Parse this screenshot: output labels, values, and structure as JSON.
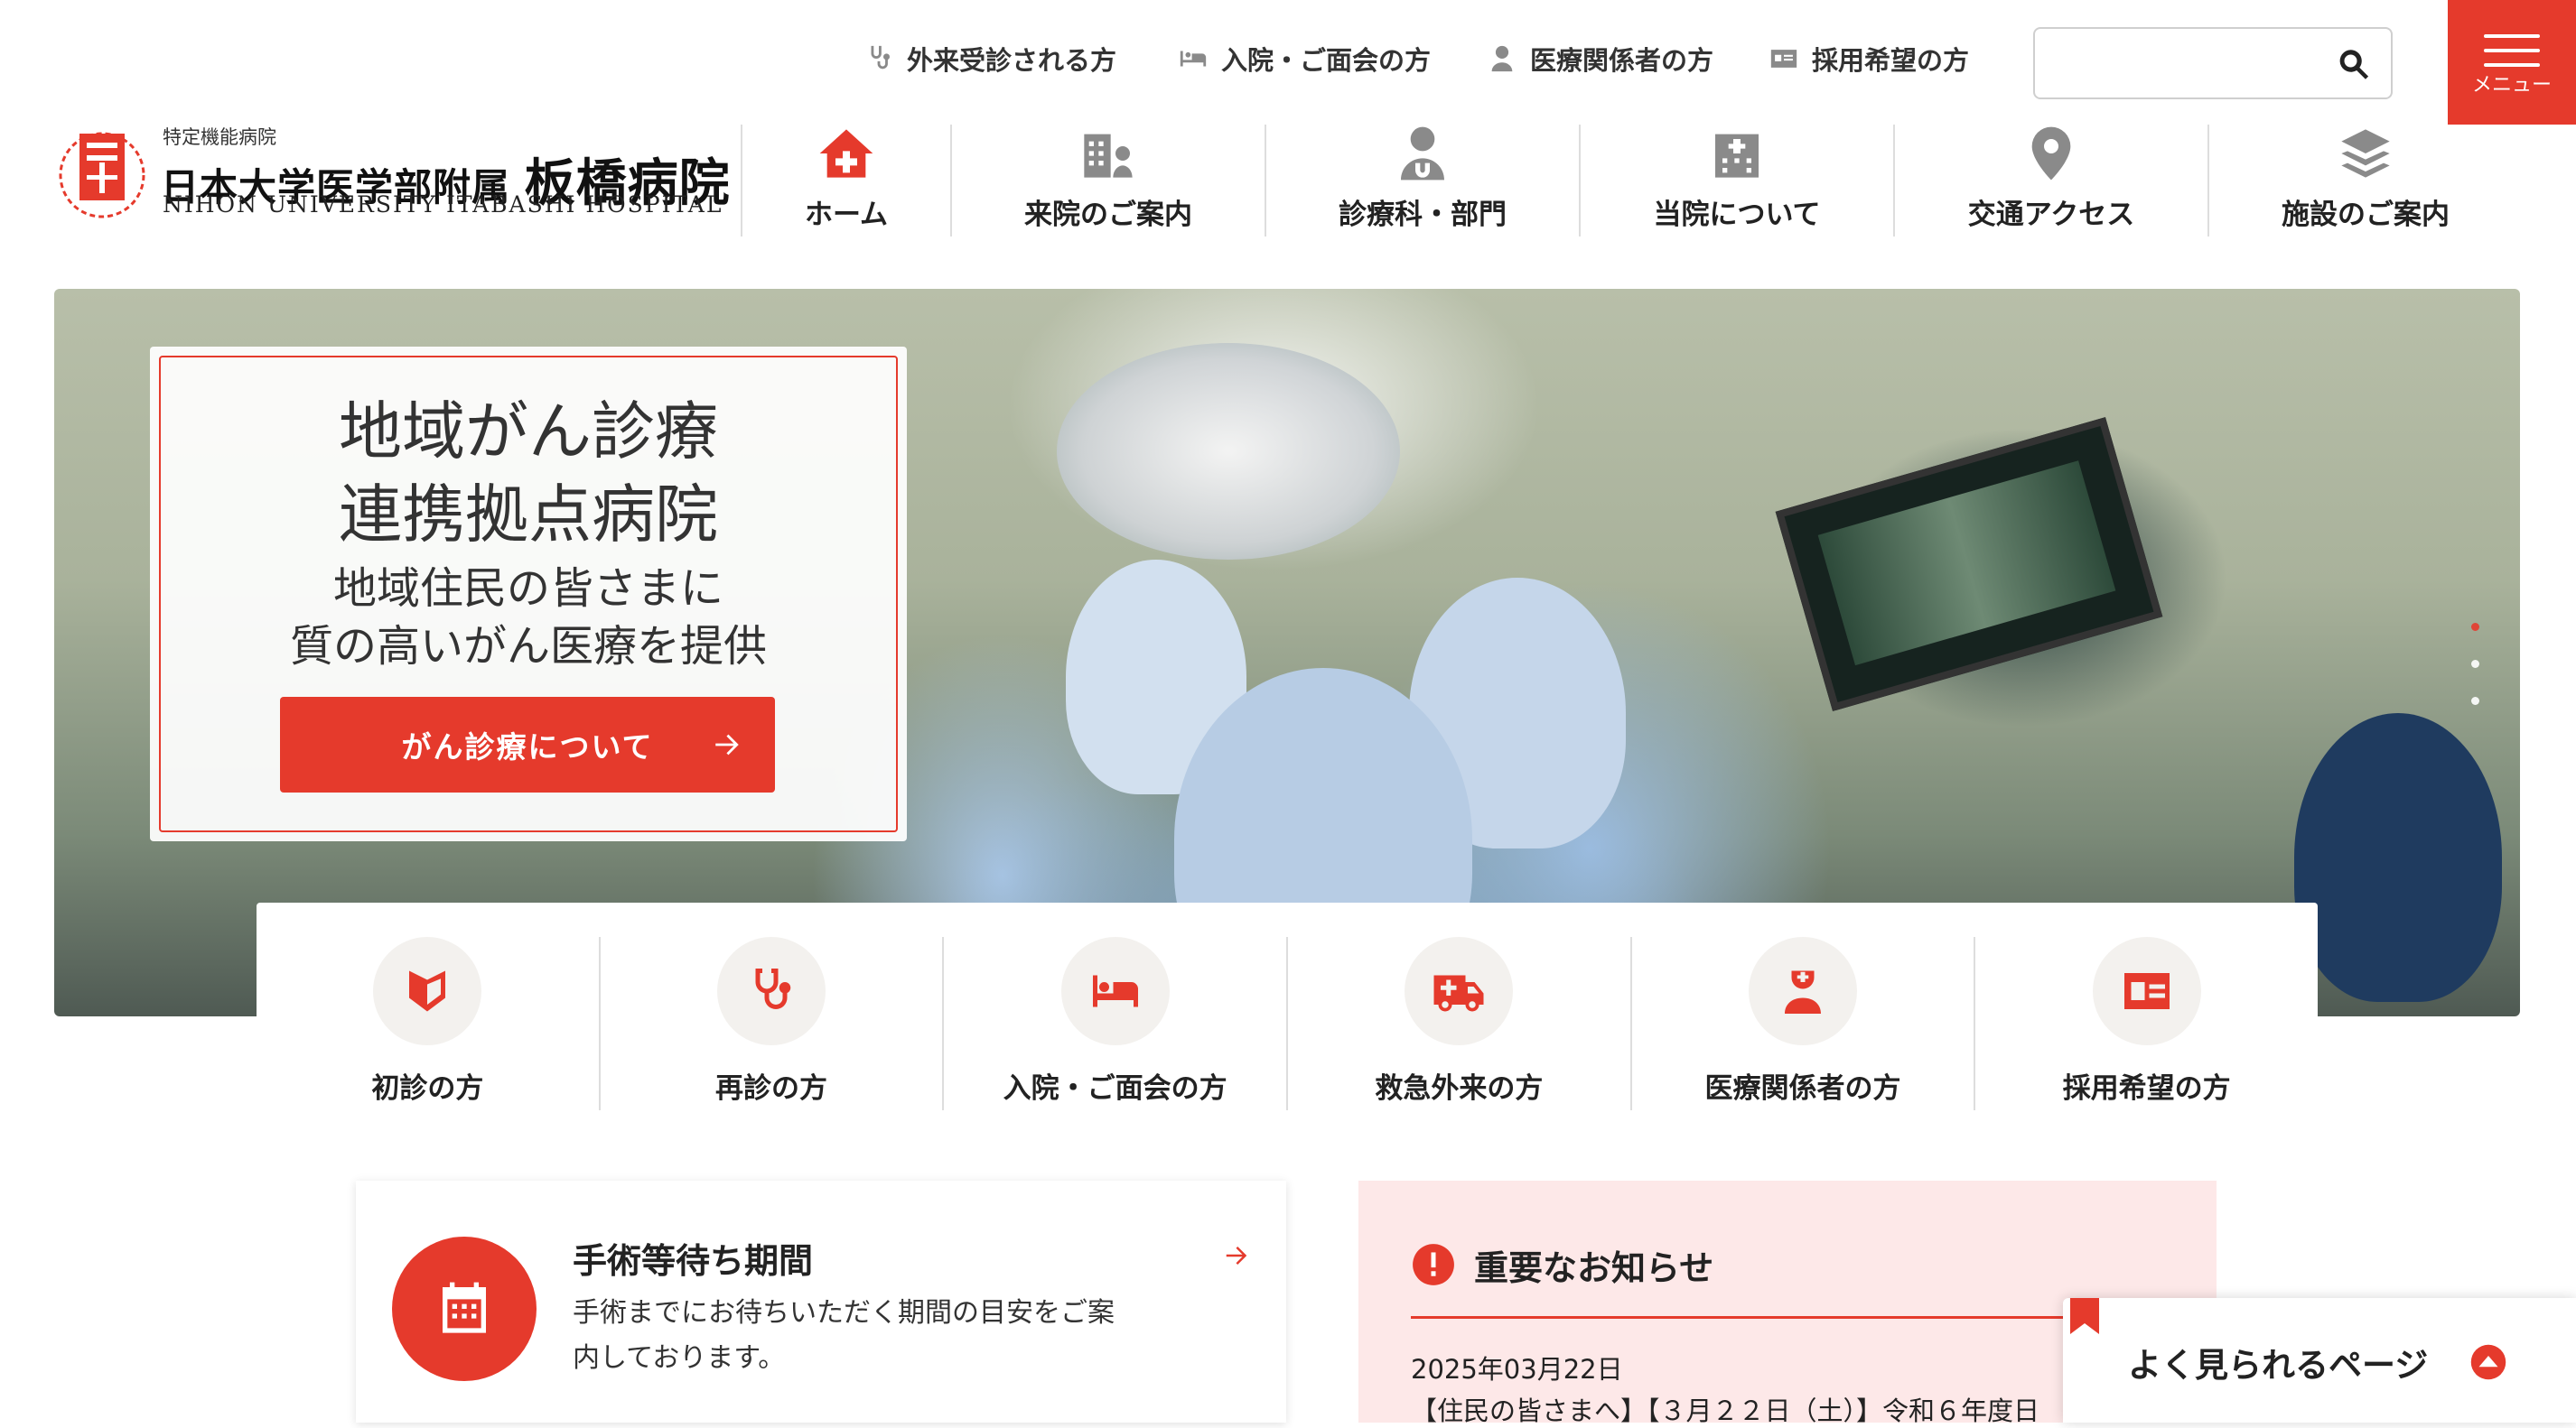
{
  "utility_links": [
    {
      "label": "外来受診される方",
      "icon": "stethoscope-icon"
    },
    {
      "label": "入院・ご面会の方",
      "icon": "bed-icon"
    },
    {
      "label": "医療関係者の方",
      "icon": "doctor-icon"
    },
    {
      "label": "採用希望の方",
      "icon": "id-card-icon"
    }
  ],
  "search": {
    "placeholder": "",
    "icon": "search-icon"
  },
  "menu": {
    "label": "メニュー"
  },
  "logo": {
    "small": "特定機能病院",
    "main": "日本大学医学部附属",
    "main_big": "板橋病院",
    "english": "NIHON UNIVERSITY ITABASHI HOSPITAL"
  },
  "nav": [
    {
      "label": "ホーム",
      "icon": "home-icon",
      "active": true
    },
    {
      "label": "来院のご案内",
      "icon": "hospital-visit-icon"
    },
    {
      "label": "診療科・部門",
      "icon": "doctor-icon"
    },
    {
      "label": "当院について",
      "icon": "hospital-icon"
    },
    {
      "label": "交通アクセス",
      "icon": "map-pin-icon"
    },
    {
      "label": "施設のご案内",
      "icon": "layers-icon"
    }
  ],
  "hero": {
    "title_line1": "地域がん診療",
    "title_line2": "連携拠点病院",
    "sub_line1": "地域住民の皆さまに",
    "sub_line2": "質の高いがん医療を提供",
    "cta": "がん診療について"
  },
  "quick_links": [
    {
      "label": "初診の方",
      "icon": "beginner-mark-icon"
    },
    {
      "label": "再診の方",
      "icon": "stethoscope-icon"
    },
    {
      "label": "入院・ご面会の方",
      "icon": "bed-icon"
    },
    {
      "label": "救急外来の方",
      "icon": "ambulance-icon"
    },
    {
      "label": "医療関係者の方",
      "icon": "doctor-icon"
    },
    {
      "label": "採用希望の方",
      "icon": "id-card-icon"
    }
  ],
  "waiting": {
    "title": "手術等待ち期間",
    "desc": "手術までにお待ちいただく期間の目安をご案内しております。"
  },
  "notice": {
    "title": "重要なお知らせ",
    "date": "2025年03月22日",
    "text": "【住民の皆さまへ】【３月２２日（土）】令和６年度日"
  },
  "popular": {
    "label": "よく見られるページ"
  },
  "colors": {
    "accent": "#e53a2c",
    "notice_bg": "#fde8e8",
    "icon_gray": "#8a8a8a"
  }
}
